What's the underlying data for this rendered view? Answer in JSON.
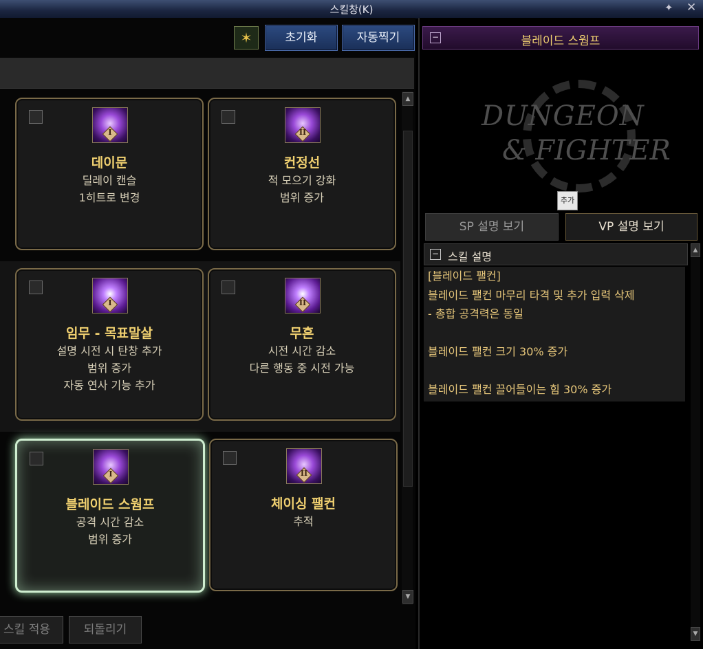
{
  "window": {
    "title": "스킬창(K)",
    "pin_icon": "pin-icon",
    "close_icon": "close-icon"
  },
  "toolbar": {
    "icon": "skill-filter-icon",
    "reset_label": "초기화",
    "auto_label": "자동찍기"
  },
  "cards": [
    {
      "name": "데이문",
      "desc": [
        "딜레이 캔슬",
        "1히트로 변경"
      ],
      "rune": "I",
      "selected": false
    },
    {
      "name": "컨정선",
      "desc": [
        "적 모으기 강화",
        "범위 증가"
      ],
      "rune": "II",
      "selected": false
    },
    {
      "name": "임무 - 목표말살",
      "desc": [
        "설명 시전 시 탄창 추가",
        "범위 증가",
        "자동 연사 기능 추가"
      ],
      "rune": "I",
      "selected": false
    },
    {
      "name": "무흔",
      "desc": [
        "시전 시간 감소",
        "다른 행동 중 시전 가능"
      ],
      "rune": "II",
      "selected": false
    },
    {
      "name": "블레이드 스웜프",
      "desc": [
        "공격 시간 감소",
        "범위 증가"
      ],
      "rune": "I",
      "selected": true
    },
    {
      "name": "체이싱 팰컨",
      "desc": [
        "추적"
      ],
      "rune": "II",
      "selected": false
    }
  ],
  "bottom": {
    "apply_label": "스킬 적용",
    "revert_label": "되돌리기"
  },
  "detail": {
    "title": "블레이드 스웜프",
    "logo_line1": "DUNGEON",
    "logo_line2": "& FIGHTER",
    "tooltip": "추가",
    "tab_sp": "SP 설명 보기",
    "tab_vp": "VP 설명 보기",
    "section_title": "스킬 설명",
    "lines": [
      "[블레이드 팰컨]",
      "블레이드 팰컨 마무리 타격 및 추가 입력 삭제",
      "- 총합 공격력은 동일",
      "",
      "블레이드 팰컨 크기 30% 증가",
      "",
      "블레이드 팰컨 끌어들이는 힘 30% 증가"
    ]
  },
  "colors": {
    "gold": "#f0d070",
    "selected_glow": "#cfeed0",
    "accent_blue": "#2c4a80"
  }
}
